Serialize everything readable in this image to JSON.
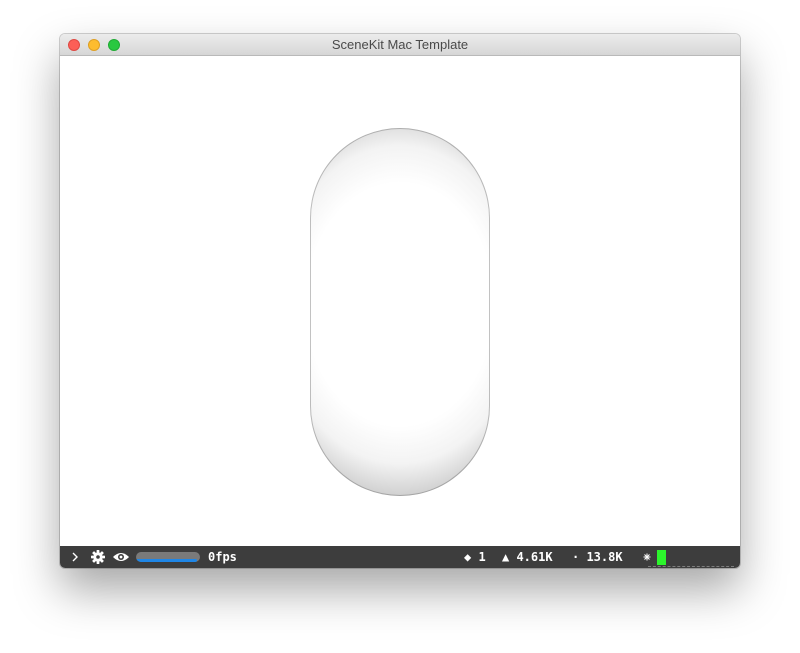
{
  "window": {
    "title": "SceneKit Mac Template"
  },
  "statistics": {
    "fps_label": "0fps",
    "nodes_value": "◆ 1",
    "triangles_value": "▲ 4.61K",
    "vertices_value": "· 13.8K",
    "progress_fraction": 0.95,
    "icons": {
      "toggle": "chevron-right-icon",
      "settings": "gear-icon",
      "visibility": "eye-icon",
      "light": "sun-icon"
    },
    "colors": {
      "progress": "#1f86e6",
      "meter": "#2cf52c",
      "bar_background": "#3d3d3d"
    }
  }
}
